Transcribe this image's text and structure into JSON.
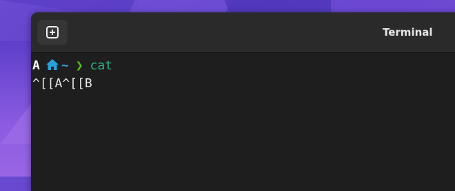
{
  "window": {
    "title": "Terminal",
    "new_tab_icon": "new-tab-plus-icon"
  },
  "terminal": {
    "prompt": {
      "user_glyph": "A",
      "home_icon": "home-icon",
      "path": "~",
      "separator": "❯",
      "command": "cat"
    },
    "output_line": "^[[A^[[B"
  },
  "colors": {
    "path": "#2aa1d6",
    "separator": "#56c41a",
    "command": "#2fb483",
    "background": "#1e1e1e"
  }
}
